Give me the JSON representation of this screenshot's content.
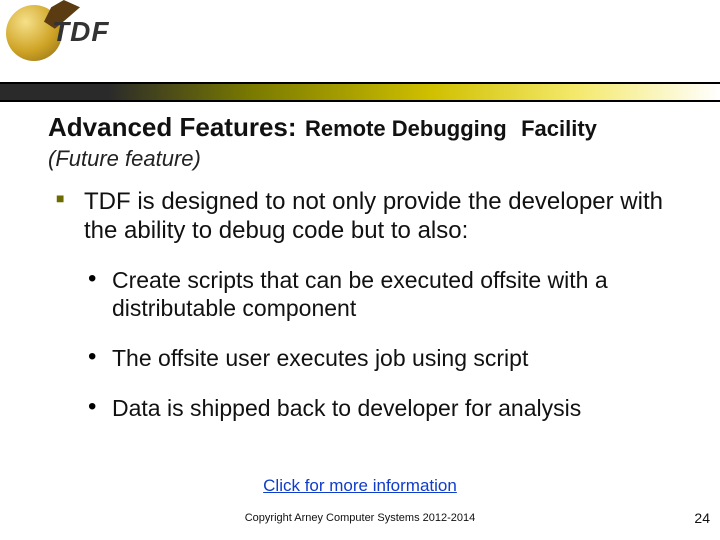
{
  "logo": {
    "text": "TDF"
  },
  "title": {
    "main": "Advanced Features:",
    "sub_a": "Remote Debugging",
    "sub_b": "Facility"
  },
  "subtitle": "(Future feature)",
  "bullets": {
    "p1": "TDF is designed to not only provide the developer with the ability to debug code but to also:",
    "sub": [
      "Create scripts that can be executed offsite with a distributable component",
      "The offsite user executes job using script",
      "Data is shipped back to developer for analysis"
    ]
  },
  "link_text": "Click for more information",
  "copyright": "Copyright Arney Computer Systems 2012-2014",
  "page_number": "24"
}
